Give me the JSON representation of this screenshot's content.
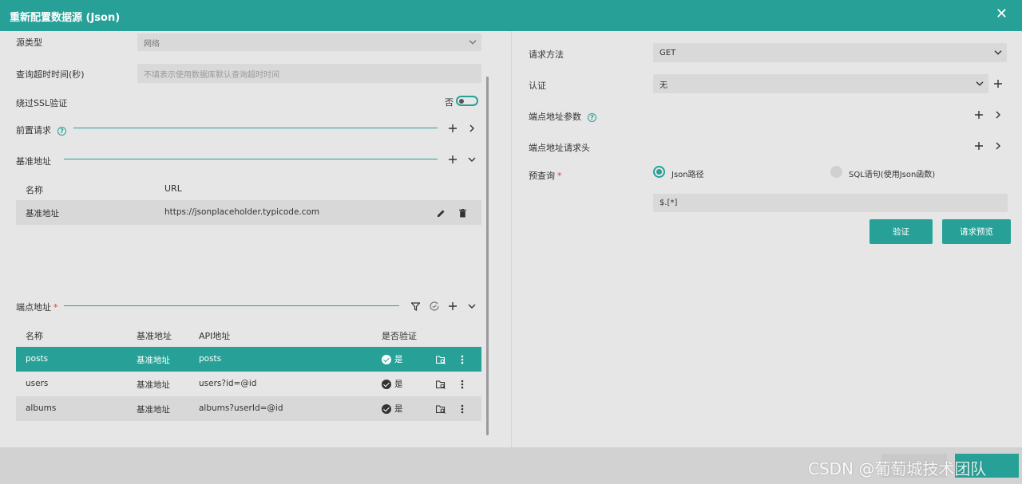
{
  "dialog": {
    "title": "重新配置数据源 (Json)",
    "close": "✕"
  },
  "left": {
    "source_type": {
      "label": "源类型",
      "value": "网络"
    },
    "timeout": {
      "label": "查询超时时间(秒)",
      "placeholder": "不填表示使用数据库默认查询超时时间"
    },
    "ssl": {
      "label": "绕过SSL验证",
      "state": "否",
      "value": false
    },
    "pre_request": {
      "label": "前置请求"
    },
    "base_url": {
      "label": "基准地址",
      "columns": [
        "名称",
        "URL"
      ],
      "rows": [
        {
          "name": "基准地址",
          "url": "https://jsonplaceholder.typicode.com"
        }
      ]
    },
    "endpoints": {
      "label": "端点地址",
      "columns": [
        "名称",
        "基准地址",
        "API地址",
        "是否验证"
      ],
      "rows": [
        {
          "name": "posts",
          "base": "基准地址",
          "api": "posts",
          "verified": "是"
        },
        {
          "name": "users",
          "base": "基准地址",
          "api": "users?id=@id",
          "verified": "是"
        },
        {
          "name": "albums",
          "base": "基准地址",
          "api": "albums?userId=@id",
          "verified": "是"
        }
      ]
    }
  },
  "right": {
    "method": {
      "label": "请求方法",
      "value": "GET"
    },
    "auth": {
      "label": "认证",
      "value": "无"
    },
    "params": {
      "label": "端点地址参数"
    },
    "headers": {
      "label": "端点地址请求头"
    },
    "prequery": {
      "label": "预查询",
      "options": [
        "Json路径",
        "SQL语句(使用Json函数)"
      ],
      "selected": "Json路径",
      "value": "$.[*]"
    },
    "buttons": {
      "verify": "验证",
      "preview": "请求预览"
    }
  },
  "watermark": "CSDN @葡萄城技术团队",
  "colors": {
    "accent": "#27a197",
    "required": "#e53935"
  }
}
